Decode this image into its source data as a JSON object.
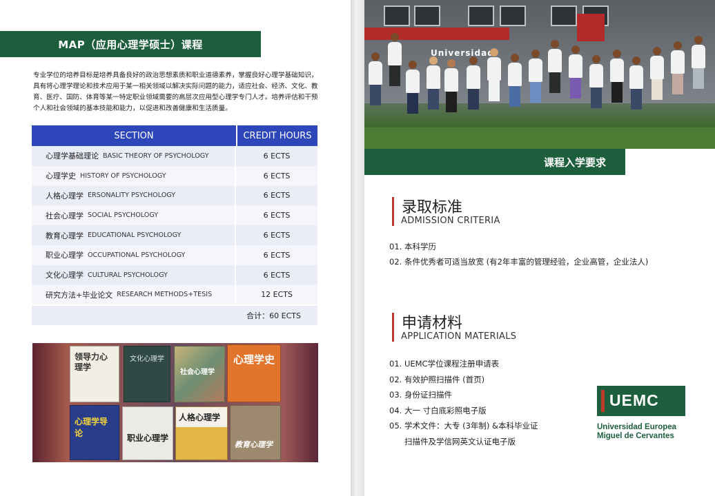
{
  "left": {
    "title": "MAP（应用心理学硕士）课程",
    "intro": "专业学位的培养目标是培养具备良好的政治思想素质和职业道德素养，掌握良好心理学基础知识，具有将心理学理论和技术应用于某一相关领域以解决实际问题的能力，适应社会、经济、文化、教育、医疗、国防、体育等某一特定职业领域需要的高层次应用型心理学专门人才。培养评估和干预个人和社会领域的基本技能和能力，以促进和改善健康和生活质量。",
    "table": {
      "headers": {
        "section": "SECTION",
        "credit_hours": "CREDIT HOURS"
      },
      "rows": [
        {
          "zh": "心理学基础理论",
          "en": "BASIC THEORY OF PSYCHOLOGY",
          "credits": "6 ECTS"
        },
        {
          "zh": "心理学史",
          "en": "HISTORY OF PSYCHOLOGY",
          "credits": "6 ECTS"
        },
        {
          "zh": "人格心理学",
          "en": "ERSONALITY PSYCHOLOGY",
          "credits": "6 ECTS"
        },
        {
          "zh": "社会心理学",
          "en": "SOCIAL PSYCHOLOGY",
          "credits": "6 ECTS"
        },
        {
          "zh": "教育心理学",
          "en": "EDUCATIONAL PSYCHOLOGY",
          "credits": "6 ECTS"
        },
        {
          "zh": "职业心理学",
          "en": "OCCUPATIONAL PSYCHOLOGY",
          "credits": "6 ECTS"
        },
        {
          "zh": "文化心理学",
          "en": "CULTURAL PSYCHOLOGY",
          "credits": "6 ECTS"
        },
        {
          "zh": "研究方法+毕业论文",
          "en": "RESEARCH METHODS+TESIS",
          "credits": "12 ECTS"
        }
      ],
      "total": "合计：60 ECTS"
    },
    "books": {
      "b1": "领导力心理学",
      "b2": "文化心理学",
      "b3": "社会心理学",
      "b4": "心理学史",
      "b5": "心理学导论",
      "b6": "职业心理学",
      "b7": "人格心理学",
      "b8": "教育心理学"
    }
  },
  "right": {
    "section_title": "课程入学要求",
    "photo_sign": "Universidad",
    "admission": {
      "zh": "录取标准",
      "en": "ADMISSION  CRITERIA",
      "items": [
        "01.  本科学历",
        "02. 条件优秀者可适当放宽 (有2年丰富的管理经验，企业高管，企业法人)"
      ]
    },
    "materials": {
      "zh": "申请材料",
      "en": "APPLICATION MATERIALS",
      "items": [
        "01. UEMC学位课程注册申请表",
        "02. 有效护照扫描件  (首页)",
        "03. 身份证扫描件",
        "04. 大一 寸白底彩照电子版",
        "05. 学术文件：大专 (3年制) &本科毕业证",
        "扫描件及学信网英文认证电子版"
      ]
    },
    "logo": {
      "mark": "UEMC",
      "line1": "Universidad Europea",
      "line2": "Miguel de Cervantes"
    }
  },
  "colors": {
    "green": "#1d5f3d",
    "blue_header": "#2d46b9",
    "red_accent": "#b93a2b",
    "row_light": "#eaedf8"
  }
}
